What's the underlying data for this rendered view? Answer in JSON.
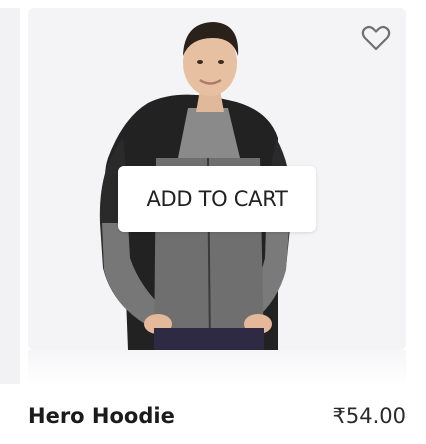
{
  "previous_card": {
    "price_fragment": ")"
  },
  "product": {
    "name": "Hero Hoodie",
    "price": "₹54.00",
    "add_to_cart_label": "ADD TO CART",
    "wishlist_icon": "heart-outline-icon"
  },
  "colors": {
    "image_background": "#f4f4f6",
    "button_background": "#ffffff",
    "text": "#1b1b1b"
  }
}
